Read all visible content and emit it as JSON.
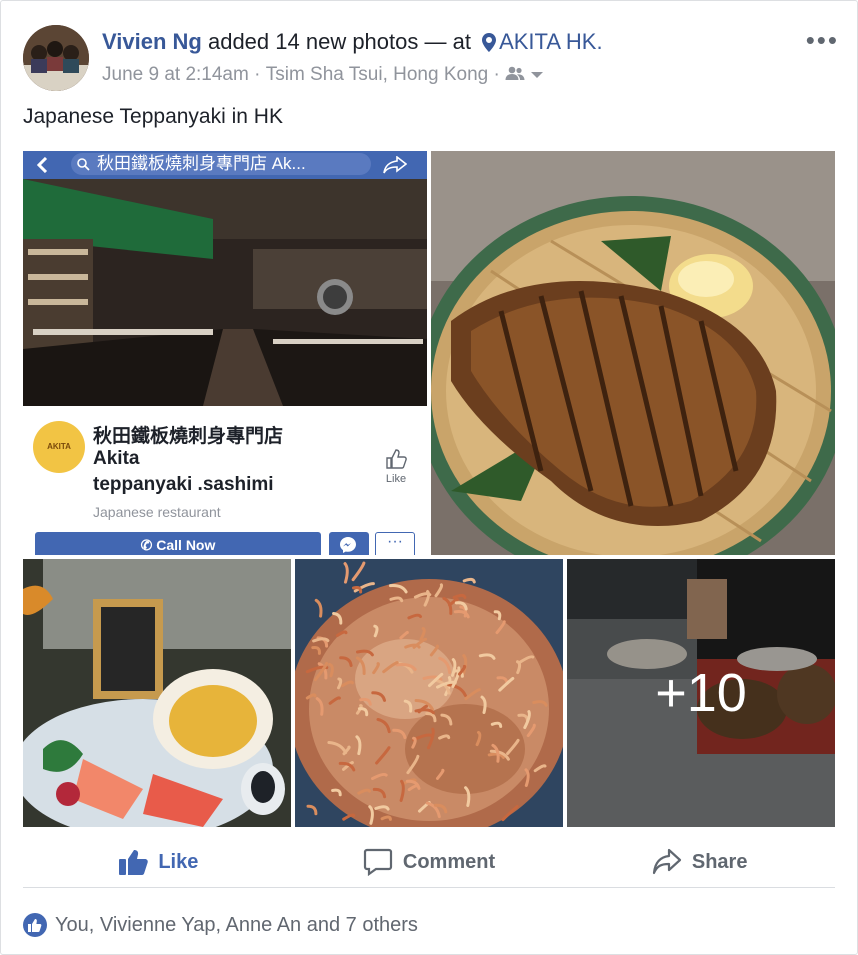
{
  "post": {
    "author": "Vivien Ng",
    "action_text": " added 14 new photos — at ",
    "location": "AKITA HK",
    "location_suffix": ".",
    "timestamp": "June 9 at 2:14am",
    "separator": " · ",
    "place": "Tsim Sha Tsui, Hong Kong",
    "audience_icon": "friends-icon",
    "more_label": "•••",
    "text": "Japanese Teppanyaki in HK"
  },
  "photos": {
    "more_count": "+10",
    "page_screenshot": {
      "search_text": "秋田鐵板燒刺身專門店 Ak...",
      "logo_text": "AKITA",
      "name_cn": "秋田鐵板燒刺身專門店",
      "name_en_1": "Akita",
      "name_en_2": "teppanyaki .sashimi",
      "category": "Japanese restaurant",
      "like_label": "Like",
      "call_label": "Call Now",
      "more_label": "···"
    }
  },
  "actions": {
    "like": "Like",
    "comment": "Comment",
    "share": "Share"
  },
  "reactions": {
    "text": "You, Vivienne Yap, Anne An and 7 others"
  },
  "colors": {
    "link_blue": "#385898",
    "fb_blue": "#4267b2",
    "meta_gray": "#90949c"
  }
}
